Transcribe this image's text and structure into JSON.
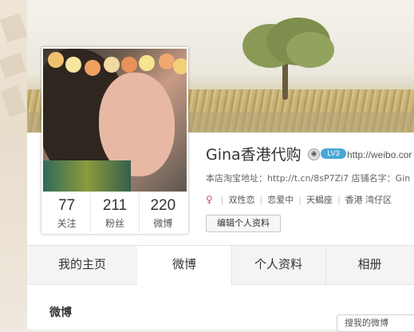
{
  "profile": {
    "name": "Gina香港代购",
    "url_text": "http://weibo.cor",
    "level_badge": "LV3",
    "description": "本店淘宝地址：http://t.cn/8sP7Zi7 店铺名字：Gin",
    "tags": [
      "双性恋",
      "恋爱中",
      "天蝎座",
      "香港 湾仔区"
    ],
    "edit_button": "编辑个人资料"
  },
  "stats": [
    {
      "value": "77",
      "label": "关注"
    },
    {
      "value": "211",
      "label": "粉丝"
    },
    {
      "value": "220",
      "label": "微博"
    }
  ],
  "tabs": [
    {
      "label": "我的主页",
      "active": false
    },
    {
      "label": "微博",
      "active": true
    },
    {
      "label": "个人资料",
      "active": false
    },
    {
      "label": "相册",
      "active": false
    }
  ],
  "section": {
    "title": "微博"
  },
  "search": {
    "placeholder": "搜我的微博"
  },
  "colors": {
    "badge": "#48a7d8",
    "gender_icon": "#d24b8c"
  },
  "icons": [
    "eye-icon",
    "female-gender-icon"
  ]
}
